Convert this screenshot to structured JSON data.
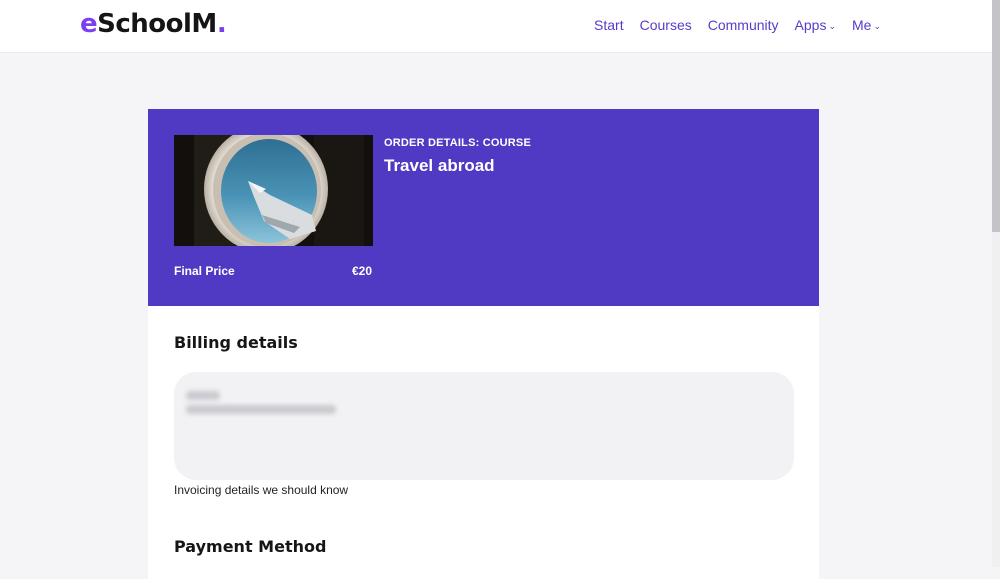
{
  "header": {
    "logo_main": "eSchoolM",
    "logo_e": "e",
    "logo_rest": "SchoolM",
    "logo_dot": ".",
    "nav": [
      {
        "label": "Start",
        "dropdown": false
      },
      {
        "label": "Courses",
        "dropdown": false
      },
      {
        "label": "Community",
        "dropdown": false
      },
      {
        "label": "Apps",
        "dropdown": true
      },
      {
        "label": "Me",
        "dropdown": true
      }
    ]
  },
  "order": {
    "eyebrow": "ORDER DETAILS: COURSE",
    "title": "Travel abroad",
    "price_label": "Final Price",
    "price_value": "€20",
    "image_icon": "airplane-window-image"
  },
  "billing": {
    "title": "Billing details",
    "helper": "Invoicing details we should know"
  },
  "payment": {
    "title": "Payment Method"
  },
  "colors": {
    "brand": "#503ac4",
    "accent": "#7b3ff2",
    "nav_link": "#5a3bc8"
  }
}
